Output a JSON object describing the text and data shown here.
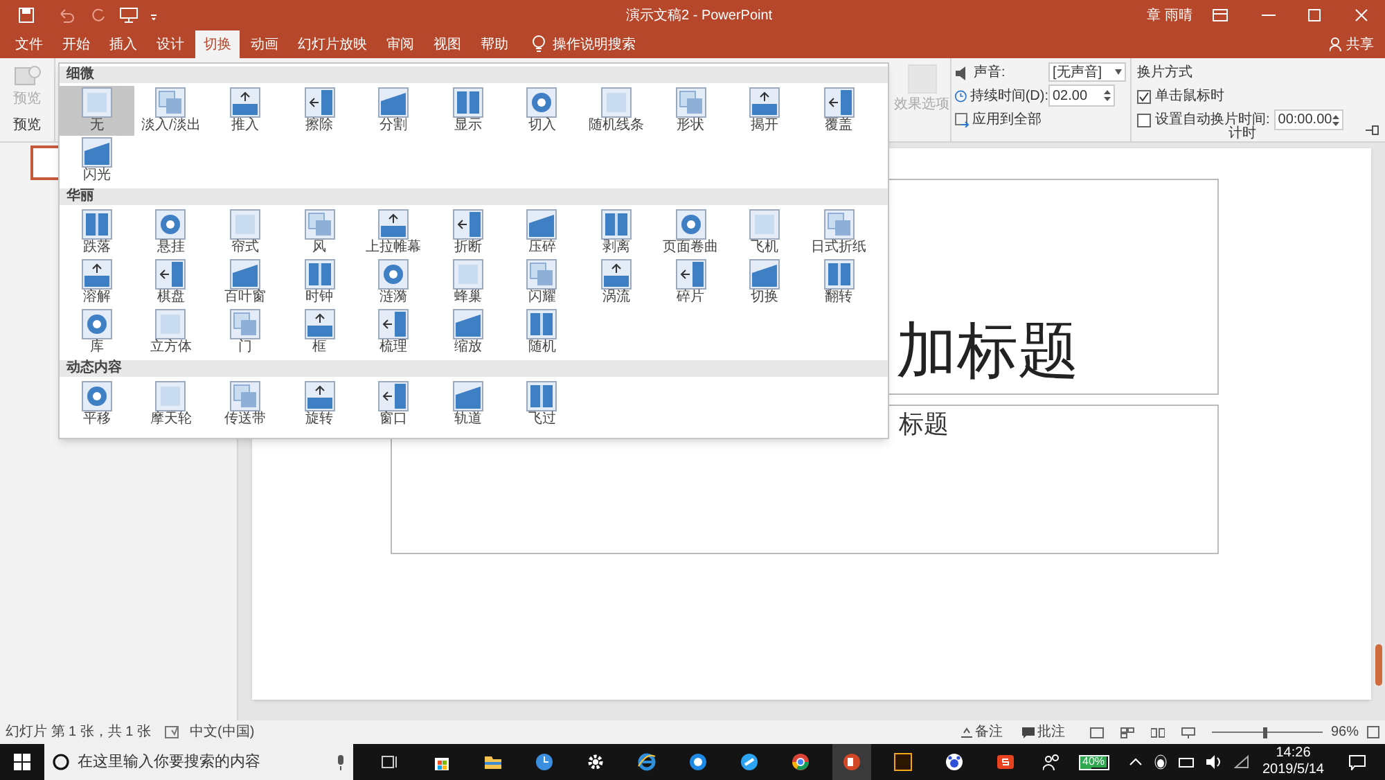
{
  "window": {
    "title": "演示文稿2 - PowerPoint",
    "user": "章 雨晴",
    "share": "共享"
  },
  "tabs": [
    {
      "label": "文件",
      "selected": false
    },
    {
      "label": "开始",
      "selected": false
    },
    {
      "label": "插入",
      "selected": false
    },
    {
      "label": "设计",
      "selected": false
    },
    {
      "label": "切换",
      "selected": true
    },
    {
      "label": "动画",
      "selected": false
    },
    {
      "label": "幻灯片放映",
      "selected": false
    },
    {
      "label": "审阅",
      "selected": false
    },
    {
      "label": "视图",
      "selected": false
    },
    {
      "label": "帮助",
      "selected": false
    }
  ],
  "tell_me": "操作说明搜索",
  "ribbon": {
    "preview_button": "预览",
    "preview_group": "预览",
    "effect_options": "效果选项",
    "sound_label": "声音:",
    "sound_value": "[无声音]",
    "duration_label": "持续时间(D):",
    "duration_value": "02.00",
    "apply_all": "应用到全部",
    "advance_heading": "换片方式",
    "on_click": {
      "label": "单击鼠标时",
      "checked": true
    },
    "after_time": {
      "label": "设置自动换片时间:",
      "checked": false
    },
    "after_value": "00:00.00",
    "timing_group": "计时"
  },
  "gallery": [
    {
      "heading": "细微",
      "items": [
        {
          "label": "无",
          "selected": true
        },
        {
          "label": "淡入/淡出",
          "selected": false
        },
        {
          "label": "推入",
          "selected": false
        },
        {
          "label": "擦除",
          "selected": false
        },
        {
          "label": "分割",
          "selected": false
        },
        {
          "label": "显示",
          "selected": false
        },
        {
          "label": "切入",
          "selected": false
        },
        {
          "label": "随机线条",
          "selected": false
        },
        {
          "label": "形状",
          "selected": false
        },
        {
          "label": "揭开",
          "selected": false
        },
        {
          "label": "覆盖",
          "selected": false
        },
        {
          "label": "闪光",
          "selected": false
        }
      ]
    },
    {
      "heading": "华丽",
      "items": [
        {
          "label": "跌落",
          "selected": false
        },
        {
          "label": "悬挂",
          "selected": false
        },
        {
          "label": "帘式",
          "selected": false
        },
        {
          "label": "风",
          "selected": false
        },
        {
          "label": "上拉帷幕",
          "selected": false
        },
        {
          "label": "折断",
          "selected": false
        },
        {
          "label": "压碎",
          "selected": false
        },
        {
          "label": "剥离",
          "selected": false
        },
        {
          "label": "页面卷曲",
          "selected": false
        },
        {
          "label": "飞机",
          "selected": false
        },
        {
          "label": "日式折纸",
          "selected": false
        },
        {
          "label": "溶解",
          "selected": false
        },
        {
          "label": "棋盘",
          "selected": false
        },
        {
          "label": "百叶窗",
          "selected": false
        },
        {
          "label": "时钟",
          "selected": false
        },
        {
          "label": "涟漪",
          "selected": false
        },
        {
          "label": "蜂巢",
          "selected": false
        },
        {
          "label": "闪耀",
          "selected": false
        },
        {
          "label": "涡流",
          "selected": false
        },
        {
          "label": "碎片",
          "selected": false
        },
        {
          "label": "切换",
          "selected": false
        },
        {
          "label": "翻转",
          "selected": false
        },
        {
          "label": "库",
          "selected": false
        },
        {
          "label": "立方体",
          "selected": false
        },
        {
          "label": "门",
          "selected": false
        },
        {
          "label": "框",
          "selected": false
        },
        {
          "label": "梳理",
          "selected": false
        },
        {
          "label": "缩放",
          "selected": false
        },
        {
          "label": "随机",
          "selected": false
        }
      ]
    },
    {
      "heading": "动态内容",
      "items": [
        {
          "label": "平移",
          "selected": false
        },
        {
          "label": "摩天轮",
          "selected": false
        },
        {
          "label": "传送带",
          "selected": false
        },
        {
          "label": "旋转",
          "selected": false
        },
        {
          "label": "窗口",
          "selected": false
        },
        {
          "label": "轨道",
          "selected": false
        },
        {
          "label": "飞过",
          "selected": false
        }
      ]
    }
  ],
  "slide": {
    "title_text": "加标题",
    "subtitle_text": "标题"
  },
  "status_bar": {
    "slide_info": "幻灯片 第 1 张，共 1 张",
    "language": "中文(中国)",
    "notes": "备注",
    "comments": "批注",
    "zoom": "96%",
    "zoom_slider": {
      "level": 0.48
    }
  },
  "taskbar": {
    "search_placeholder": "在这里输入你要搜索的内容",
    "battery": "40%",
    "time": "14:26",
    "date": "2019/5/14"
  }
}
